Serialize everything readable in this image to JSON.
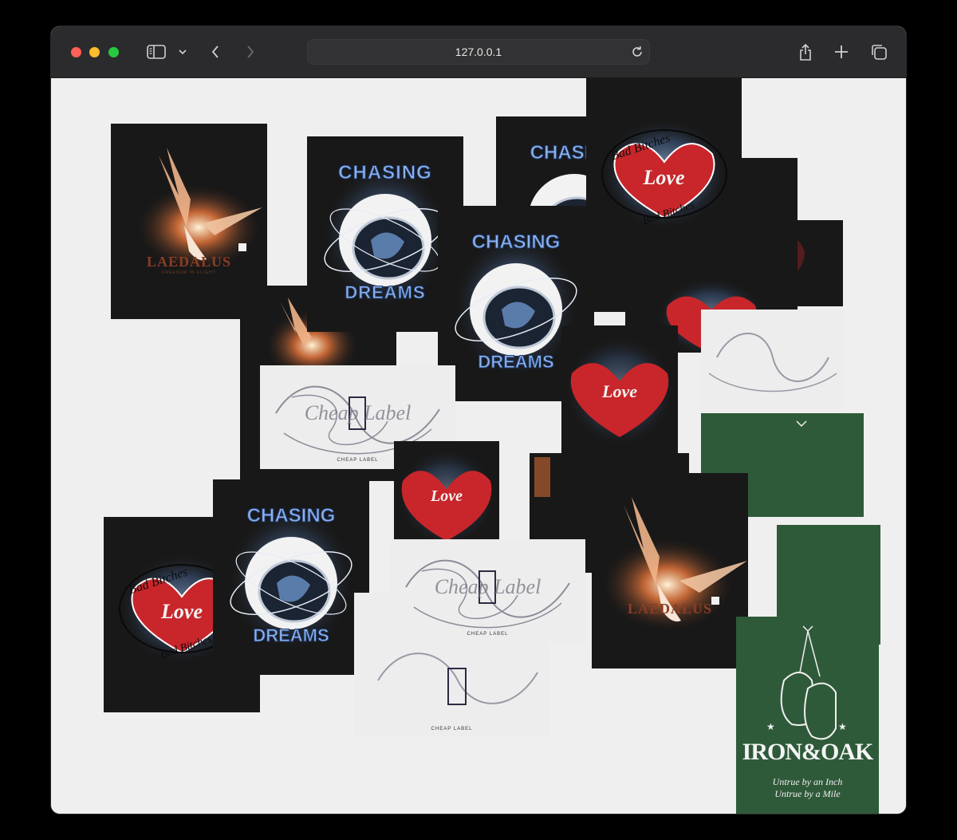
{
  "browser": {
    "url": "127.0.0.1",
    "icons": [
      "sidebar-icon",
      "chevron-down-icon",
      "back-icon",
      "forward-icon",
      "reload-icon",
      "share-icon",
      "new-tab-icon",
      "tabs-overview-icon"
    ]
  },
  "designs": {
    "chasing": {
      "line1": "CHASING",
      "line2": "DREAMS"
    },
    "angel": {
      "word": "LAEDALUS",
      "sub": "FREEDOM IN FLIGHT"
    },
    "heart": {
      "top": "Bad Bitches",
      "center": "Love",
      "bottom": "Bad Bitches"
    },
    "cheap": {
      "word": "Cheap Label",
      "sub": "CHEAP LABEL"
    },
    "iron": {
      "title": "IRON&OAK",
      "line1": "Untrue by an Inch",
      "line2": "Untrue by a Mile"
    }
  },
  "colors": {
    "dark_card": "#181818",
    "light_card": "#ededed",
    "green_card": "#2f5a3a",
    "heart_red": "#c8262b",
    "dream_blue": "#7fa6e0",
    "flame": "#e0733a"
  }
}
